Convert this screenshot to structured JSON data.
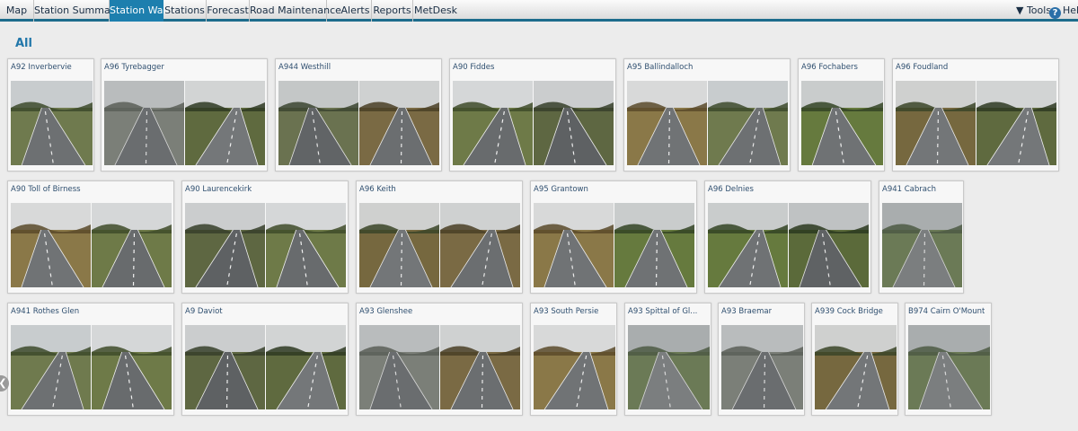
{
  "nav": {
    "tabs": [
      {
        "label": "Map"
      },
      {
        "label": "Station Summary"
      },
      {
        "label": "Station Wall",
        "active": true
      },
      {
        "label": "Stations"
      },
      {
        "label": "Forecast"
      },
      {
        "label": "Road Maintenance"
      },
      {
        "label": "Alerts"
      },
      {
        "label": "Reports"
      },
      {
        "label": "MetDesk"
      }
    ],
    "tools_label": "▼ Tools",
    "help_label": "Help",
    "help_icon_glyph": "?"
  },
  "page_title": "All",
  "accent_color": "#1d7fae",
  "scroll_handle_glyph": "❮",
  "stations": [
    {
      "name": "A92 Inverbervie",
      "cameras": [
        "road-curve-hills",
        "",
        ""
      ]
    },
    {
      "name": "A96 Tyrebagger",
      "cameras": [
        "fog-lanes",
        "trees-barrier"
      ]
    },
    {
      "name": "A944 Westhill",
      "cameras": [
        "town-road",
        "trees-road"
      ]
    },
    {
      "name": "A90 Fiddes",
      "cameras": [
        "dual-carriageway",
        "dual-carriageway-truck"
      ]
    },
    {
      "name": "A95 Ballindalloch",
      "cameras": [
        "rural-hedge",
        "rural-curve"
      ]
    },
    {
      "name": "A96 Fochabers",
      "cameras": [
        "grass-verge-road"
      ]
    },
    {
      "name": "A96 Foudland",
      "cameras": [
        "wide-road-trees",
        "wide-road-hills"
      ]
    },
    {
      "name": "A90 Toll of Birness",
      "cameras": [
        "brown-field-road",
        "brown-field-van"
      ]
    },
    {
      "name": "A90 Laurencekirk",
      "cameras": [
        "dual-barrier",
        "dual-barrier-2"
      ]
    },
    {
      "name": "A96 Keith",
      "cameras": [
        "autumn-road",
        "autumn-road-lorry"
      ]
    },
    {
      "name": "A95 Grantown",
      "cameras": [
        "forest-road",
        "forest-road-2"
      ]
    },
    {
      "name": "A96 Delnies",
      "cameras": [
        "grass-road",
        "road-cars"
      ]
    },
    {
      "name": "A941 Cabrach",
      "cameras": [
        "foggy-moor"
      ]
    },
    {
      "name": "A941 Rothes Glen",
      "cameras": [
        "houses-road",
        "field-road"
      ]
    },
    {
      "name": "A9 Daviot",
      "cameras": [
        "a9-dual",
        "a9-dual-2"
      ]
    },
    {
      "name": "A93 Glenshee",
      "cameras": [
        "glen-fog",
        "glen-fog-2"
      ]
    },
    {
      "name": "A93 South Persie",
      "cameras": [
        "persie-road"
      ]
    },
    {
      "name": "A93 Spittal of Gl...",
      "cameras": [
        "glen-hills"
      ]
    },
    {
      "name": "A93 Braemar",
      "cameras": [
        "braemar-fog"
      ]
    },
    {
      "name": "A939 Cock Bridge",
      "cameras": [
        "pine-trees-road"
      ]
    },
    {
      "name": "B974 Cairn O'Mount",
      "cameras": [
        "misty-forest"
      ]
    }
  ]
}
